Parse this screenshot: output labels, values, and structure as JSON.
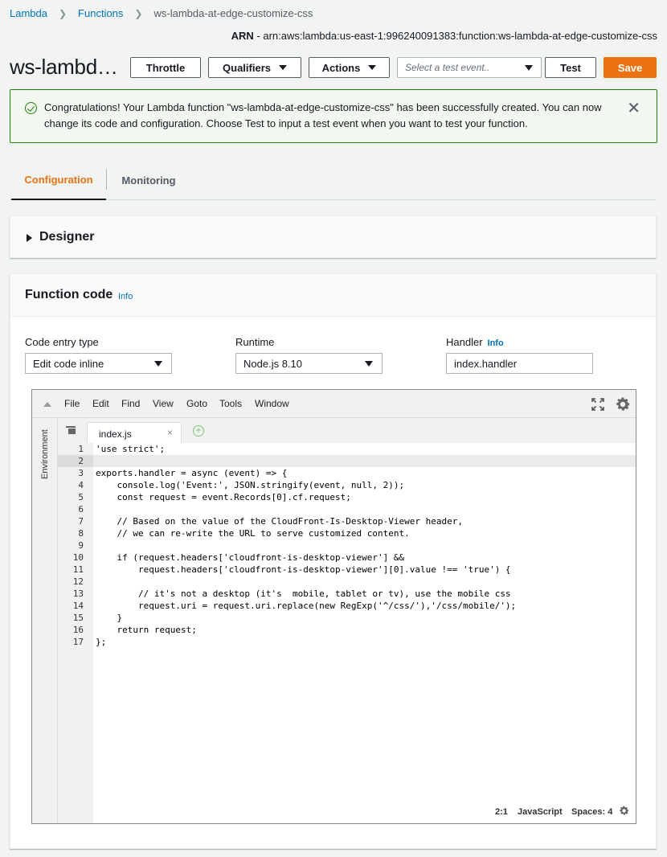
{
  "breadcrumb": {
    "items": [
      "Lambda",
      "Functions",
      "ws-lambda-at-edge-customize-css"
    ]
  },
  "arn": {
    "label": "ARN",
    "value": " - arn:aws:lambda:us-east-1:996240091383:function:ws-lambda-at-edge-customize-css"
  },
  "function_title": "ws-lambd…",
  "toolbar": {
    "throttle": "Throttle",
    "qualifiers": "Qualifiers",
    "actions": "Actions",
    "test_event_placeholder": "Select a test event..",
    "test": "Test",
    "save": "Save"
  },
  "alert": {
    "message": "Congratulations! Your Lambda function \"ws-lambda-at-edge-customize-css\" has been successfully created. You can now change its code and configuration. Choose Test to input a test event when you want to test your function.",
    "close": "✕"
  },
  "tabs": {
    "configuration": "Configuration",
    "monitoring": "Monitoring"
  },
  "designer": {
    "title": "Designer"
  },
  "function_code": {
    "title": "Function code",
    "info": "Info",
    "code_entry_label": "Code entry type",
    "code_entry_value": "Edit code inline",
    "runtime_label": "Runtime",
    "runtime_value": "Node.js 8.10",
    "handler_label": "Handler",
    "handler_info": "Info",
    "handler_value": "index.handler"
  },
  "ide": {
    "menu": [
      "File",
      "Edit",
      "Find",
      "View",
      "Goto",
      "Tools",
      "Window"
    ],
    "environment_label": "Environment",
    "file_tab": "index.js",
    "file_tab_close": "×",
    "new_tab": "+",
    "code_lines": [
      "'use strict';",
      "",
      "exports.handler = async (event) => {",
      "    console.log('Event:', JSON.stringify(event, null, 2));",
      "    const request = event.Records[0].cf.request;",
      "",
      "    // Based on the value of the CloudFront-Is-Desktop-Viewer header,",
      "    // we can re-write the URL to serve customized content.",
      "",
      "    if (request.headers['cloudfront-is-desktop-viewer'] &&",
      "        request.headers['cloudfront-is-desktop-viewer'][0].value !== 'true') {",
      "",
      "        // it's not a desktop (it's  mobile, tablet or tv), use the mobile css",
      "        request.uri = request.uri.replace(new RegExp('^/css/'),'/css/mobile/');",
      "    }",
      "    return request;",
      "};"
    ],
    "active_line": 2,
    "status": {
      "position": "2:1",
      "language": "JavaScript",
      "spaces": "Spaces: 4"
    }
  },
  "colors": {
    "accent_orange": "#ec7211",
    "link_blue": "#0073bb",
    "success_green": "#1d8102"
  }
}
